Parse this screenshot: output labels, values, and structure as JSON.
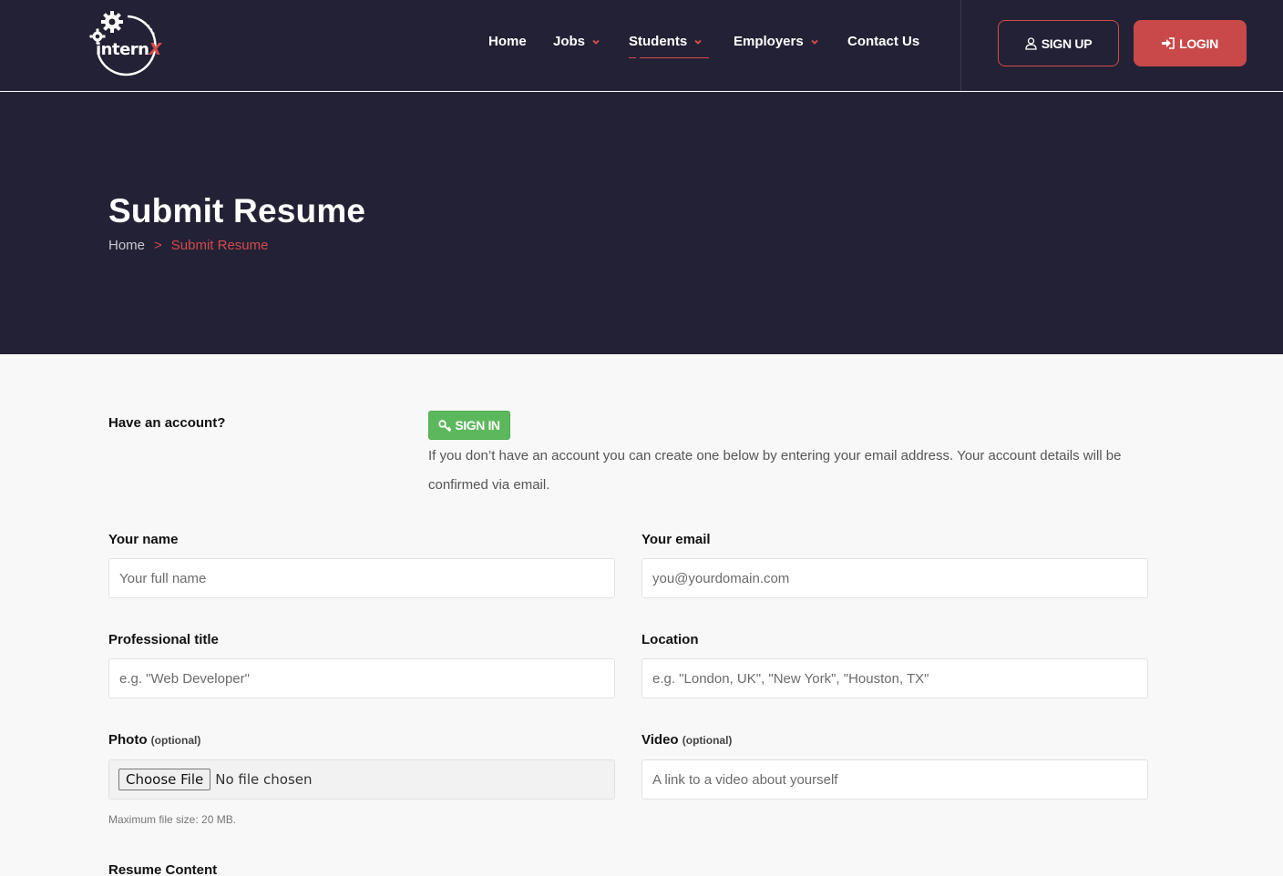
{
  "brand": {
    "logo_text": "intern",
    "logo_accent": "X"
  },
  "nav": {
    "items": [
      {
        "label": "Home",
        "has_dropdown": false
      },
      {
        "label": "Jobs",
        "has_dropdown": true
      },
      {
        "label": "Students",
        "has_dropdown": true,
        "active": true
      },
      {
        "label": "Employers",
        "has_dropdown": true
      },
      {
        "label": "Contact Us",
        "has_dropdown": false
      }
    ],
    "signup_label": "SIGN UP",
    "login_label": "LOGIN"
  },
  "hero": {
    "title": "Submit Resume",
    "breadcrumb": {
      "home": "Home",
      "separator": ">",
      "current": "Submit Resume"
    }
  },
  "account": {
    "question": "Have an account?",
    "signin_label": "SIGN IN",
    "note": "If you don’t have an account you can create one below by entering your email address. Your account details will be confirmed via email."
  },
  "form": {
    "name": {
      "label": "Your name",
      "placeholder": "Your full name",
      "value": ""
    },
    "email": {
      "label": "Your email",
      "placeholder": "you@yourdomain.com",
      "value": ""
    },
    "title": {
      "label": "Professional title",
      "placeholder": "e.g. \"Web Developer\"",
      "value": ""
    },
    "location": {
      "label": "Location",
      "placeholder": "e.g. \"London, UK\", \"New York\", \"Houston, TX\"",
      "value": ""
    },
    "photo": {
      "label": "Photo",
      "optional": "(optional)",
      "button": "Choose File",
      "status": "No file chosen",
      "hint": "Maximum file size: 20 MB."
    },
    "video": {
      "label": "Video",
      "optional": "(optional)",
      "placeholder": "A link to a video about yourself",
      "value": ""
    },
    "resume_content": {
      "label": "Resume Content"
    }
  },
  "colors": {
    "header_bg": "#232135",
    "accent": "#d24b4b",
    "login_bg": "#c9494a",
    "signin_green": "#5cb85c",
    "page_bg": "#f8f8f8"
  },
  "icons": {
    "signup": "user-icon",
    "login": "sign-in-icon",
    "signin": "key-icon",
    "dropdown": "chevron-down-icon"
  }
}
